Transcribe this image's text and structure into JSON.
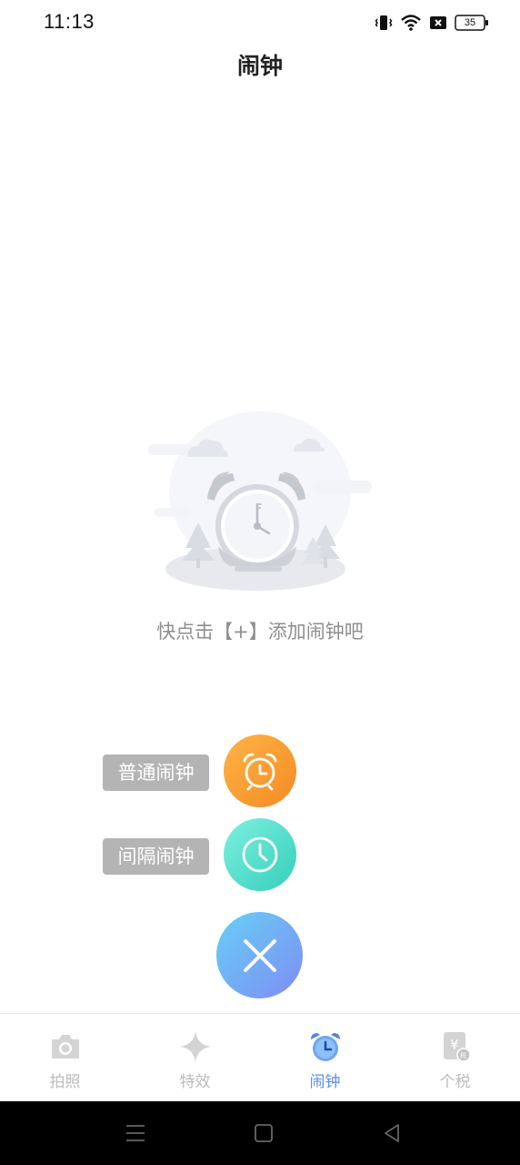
{
  "status_bar": {
    "time": "11:13",
    "battery": "35",
    "icons": [
      "vibrate-icon",
      "wifi-icon",
      "sim-off-icon",
      "battery-icon"
    ]
  },
  "header": {
    "title": "闹钟"
  },
  "empty_state": {
    "illustration": "alarm-clock-illustration",
    "hint": "快点击【+】添加闹钟吧"
  },
  "fab_menu": {
    "items": [
      {
        "label": "普通闹钟",
        "icon": "alarm-clock-icon",
        "color": "#f7952e"
      },
      {
        "label": "间隔闹钟",
        "icon": "interval-clock-icon",
        "color": "#45d8c4"
      }
    ],
    "close_icon": "close-icon",
    "close_color": "#6fa8f4"
  },
  "tab_bar": {
    "active_color": "#5b8cf0",
    "inactive_color": "#bbbbbb",
    "tabs": [
      {
        "label": "拍照",
        "icon": "camera-icon",
        "active": false
      },
      {
        "label": "特效",
        "icon": "sparkle-icon",
        "active": false
      },
      {
        "label": "闹钟",
        "icon": "alarm-clock-icon",
        "active": true
      },
      {
        "label": "个税",
        "icon": "tax-icon",
        "active": false
      }
    ]
  },
  "system_nav": {
    "buttons": [
      "menu-icon",
      "home-icon",
      "back-icon"
    ]
  }
}
